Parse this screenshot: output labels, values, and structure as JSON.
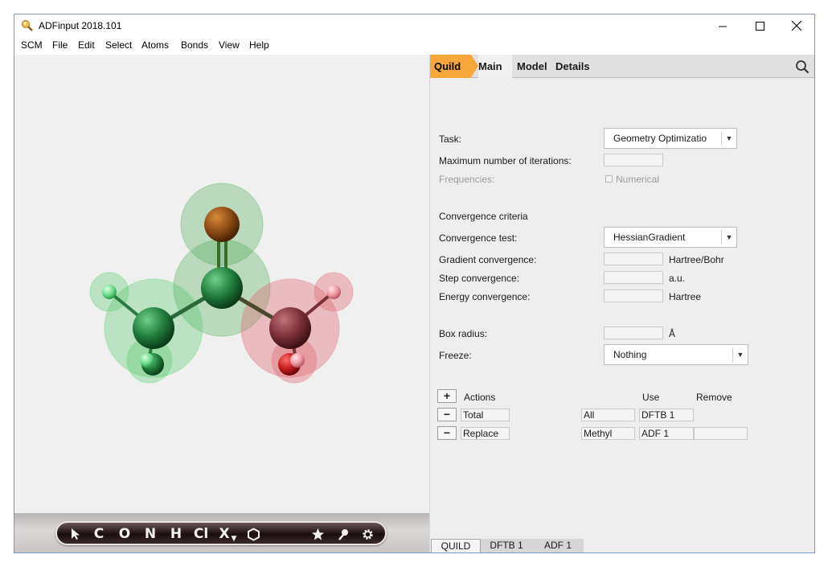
{
  "window": {
    "title": "ADFinput 2018.101"
  },
  "menu": [
    "SCM",
    "File",
    "Edit",
    "Select",
    "Atoms",
    "Bonds",
    "View",
    "Help"
  ],
  "toolbar": {
    "tools": [
      "C",
      "O",
      "N",
      "H",
      "Cl",
      "X"
    ]
  },
  "tabs": {
    "quild": "Quild",
    "main": "Main",
    "model": "Model",
    "details": "Details"
  },
  "form": {
    "task_label": "Task:",
    "task_value": "Geometry Optimizatio",
    "max_iter_label": "Maximum number of iterations:",
    "freq_label": "Frequencies:",
    "freq_checkbox_label": "Numerical",
    "conv_heading": "Convergence criteria",
    "conv_test_label": "Convergence test:",
    "conv_test_value": "HessianGradient",
    "grad_label": "Gradient convergence:",
    "grad_unit": "Hartree/Bohr",
    "step_label": "Step convergence:",
    "step_unit": "a.u.",
    "energy_label": "Energy convergence:",
    "energy_unit": "Hartree",
    "box_label": "Box radius:",
    "box_unit": "Å",
    "freeze_label": "Freeze:",
    "freeze_value": "Nothing"
  },
  "actions": {
    "header": "Actions",
    "use_header": "Use",
    "remove_header": "Remove",
    "add_symbol": "+",
    "remove_symbol": "−",
    "rows": [
      {
        "action": "Total",
        "region": "All",
        "use": "DFTB 1",
        "remove": ""
      },
      {
        "action": "Replace",
        "region": "Methyl",
        "use": "ADF 1",
        "remove": ""
      }
    ]
  },
  "bottom_tabs": [
    "QUILD",
    "DFTB 1",
    "ADF 1"
  ]
}
